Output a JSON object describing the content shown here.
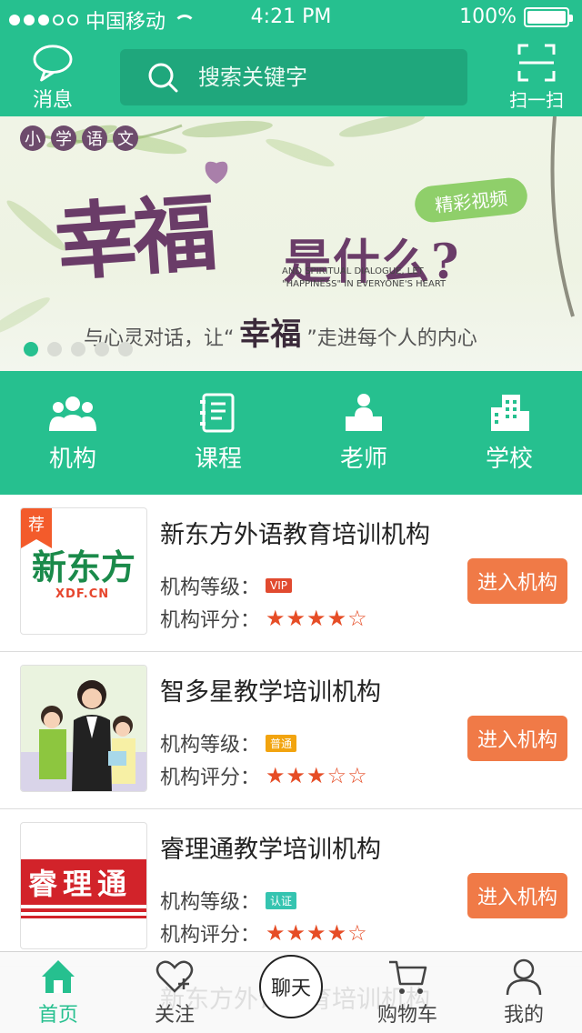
{
  "status_bar": {
    "carrier": "中国移动",
    "time": "4:21 PM",
    "battery": "100%"
  },
  "header": {
    "message_label": "消息",
    "search_placeholder": "搜索关键字",
    "scan_label": "扫一扫"
  },
  "banner": {
    "tags": [
      "小",
      "学",
      "语",
      "文"
    ],
    "title": "幸福",
    "subtitle": "是什么?",
    "badge": "精彩视频",
    "english": [
      "AND SPIRITUAL DIALOGUE, LET",
      "\"HAPPINESS\" IN EVERYONE'S HEART"
    ],
    "slogan_prefix": "与心灵对话，让“",
    "slogan_highlight": "幸福",
    "slogan_suffix": "”走进每个人的内心",
    "active_slide": 0,
    "slide_count": 5
  },
  "categories": [
    {
      "label": "机构",
      "icon": "people-icon"
    },
    {
      "label": "课程",
      "icon": "notebook-icon"
    },
    {
      "label": "老师",
      "icon": "teacher-icon"
    },
    {
      "label": "学校",
      "icon": "building-icon"
    }
  ],
  "list_labels": {
    "level": "机构等级：",
    "rating": "机构评分：",
    "enter": "进入机构"
  },
  "institutions": [
    {
      "name": "新东方外语教育培训机构",
      "recommend": "荐",
      "level": "VIP",
      "level_color": "#e14a2f",
      "stars": "★★★★☆",
      "rating": 4,
      "logo_text": "新东方",
      "logo_sub": "XDF.CN"
    },
    {
      "name": "智多星教学培训机构",
      "level": "普通",
      "level_color": "#f2a40f",
      "stars": "★★★☆☆",
      "rating": 3
    },
    {
      "name": "睿理通教学培训机构",
      "level": "认证",
      "level_color": "#35c4b0",
      "stars": "★★★★☆",
      "rating": 4,
      "logo_text": "睿理通"
    }
  ],
  "tabbar": {
    "home": "首页",
    "follow": "关注",
    "chat": "聊天",
    "cart": "购物车",
    "mine": "我的",
    "ghost_text": "新东方外语教育培训机构"
  },
  "colors": {
    "brand": "#26c08f",
    "accent": "#f07a47",
    "star": "#e64d26"
  }
}
